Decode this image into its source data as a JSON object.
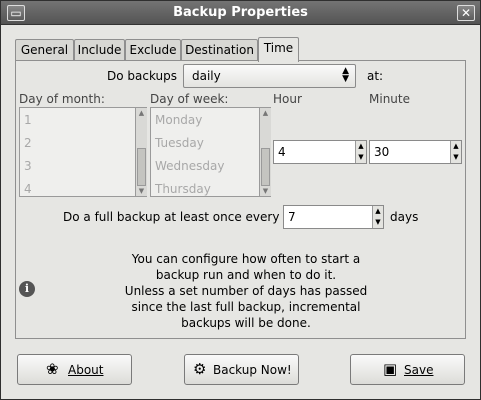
{
  "window": {
    "title": "Backup Properties",
    "close_glyph": "✕"
  },
  "tabs": [
    {
      "label": "General",
      "active": false
    },
    {
      "label": "Include",
      "active": false
    },
    {
      "label": "Exclude",
      "active": false
    },
    {
      "label": "Destination",
      "active": false
    },
    {
      "label": "Time",
      "active": true
    }
  ],
  "schedule": {
    "do_backups_label": "Do backups",
    "frequency_value": "daily",
    "at_label": "at:",
    "day_of_month_label": "Day of month:",
    "day_of_week_label": "Day of week:",
    "hour_label": "Hour",
    "minute_label": "Minute",
    "day_of_month_items": [
      "1",
      "2",
      "3",
      "4"
    ],
    "day_of_week_items": [
      "Monday",
      "Tuesday",
      "Wednesday",
      "Thursday"
    ],
    "hour_value": "4",
    "minute_value": "30"
  },
  "full_backup": {
    "prefix": "Do a full backup at least once every",
    "days_value": "7",
    "suffix": "days"
  },
  "info": {
    "lines": [
      "You can configure how often to start a",
      "backup run and when to do it.",
      "Unless a set number of days has passed",
      "since the last full backup, incremental",
      "backups will be done."
    ]
  },
  "buttons": {
    "about_label": "About",
    "backup_now_label": "Backup Now!",
    "save_label": "Save"
  },
  "icons": {
    "about": "about-icon",
    "backup_now": "gears-icon",
    "save": "floppy-disk-icon",
    "info": "info-icon"
  }
}
